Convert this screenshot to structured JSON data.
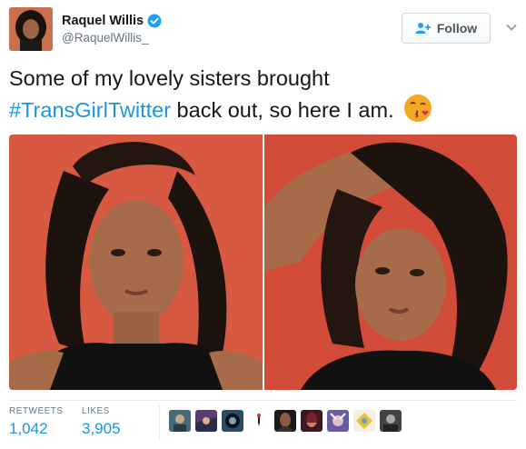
{
  "author": {
    "name": "Raquel Willis",
    "handle": "@RaquelWillis_",
    "verified": true
  },
  "follow_button": {
    "label": "Follow",
    "icon": "follow-user-icon"
  },
  "menu": {
    "icon": "chevron-down-icon"
  },
  "tweet": {
    "text_line1": "Some of my lovely sisters brought",
    "hashtag": "#TransGirlTwitter",
    "text_line2_rest": " back out, so here I am.",
    "emoji": "face-blowing-a-kiss"
  },
  "media": {
    "photos": [
      {
        "description_icon": "selfie-photo-1"
      },
      {
        "description_icon": "selfie-photo-2"
      }
    ]
  },
  "stats": {
    "retweets_label": "RETWEETS",
    "retweets_value": "1,042",
    "likes_label": "LIKES",
    "likes_value": "3,905"
  },
  "likers_count": 9,
  "colors": {
    "link": "#1b95e0",
    "text": "#14171a",
    "muted": "#657786",
    "verified": "#1da1f2",
    "photo_wall": "#d5503d"
  }
}
